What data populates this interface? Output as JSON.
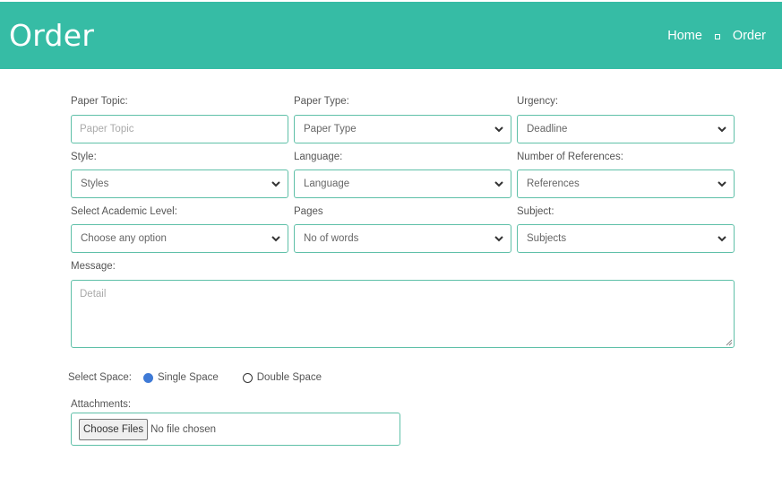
{
  "header": {
    "title": "Order",
    "breadcrumb": [
      {
        "label": "Home"
      },
      {
        "label": "Order"
      }
    ],
    "color": "#36bca5"
  },
  "form": {
    "fields": [
      {
        "label": "Paper Topic:",
        "type": "input",
        "placeholder": "Paper Topic",
        "value": ""
      },
      {
        "label": "Paper Type:",
        "type": "select",
        "selected": "Paper Type"
      },
      {
        "label": "Urgency:",
        "type": "select",
        "selected": "Deadline"
      },
      {
        "label": "Style:",
        "type": "select",
        "selected": "Styles"
      },
      {
        "label": "Language:",
        "type": "select",
        "selected": "Language"
      },
      {
        "label": "Number of References:",
        "type": "select",
        "selected": "References"
      },
      {
        "label": "Select Academic Level:",
        "type": "select",
        "selected": "Choose any option"
      },
      {
        "label": "Pages",
        "type": "select",
        "selected": "No of words"
      },
      {
        "label": "Subject:",
        "type": "select",
        "selected": "Subjects"
      }
    ],
    "message": {
      "label": "Message:",
      "placeholder": "Detail",
      "value": ""
    },
    "spacing": {
      "label": "Select Space:",
      "options": [
        {
          "label": "Single Space",
          "checked": true
        },
        {
          "label": "Double Space",
          "checked": false
        }
      ]
    },
    "attachments": {
      "label": "Attachments:",
      "button_label": "Choose Files",
      "status": "No file chosen"
    },
    "border_color": "#5fc0a8",
    "radio_color": "#3f7ad6"
  }
}
